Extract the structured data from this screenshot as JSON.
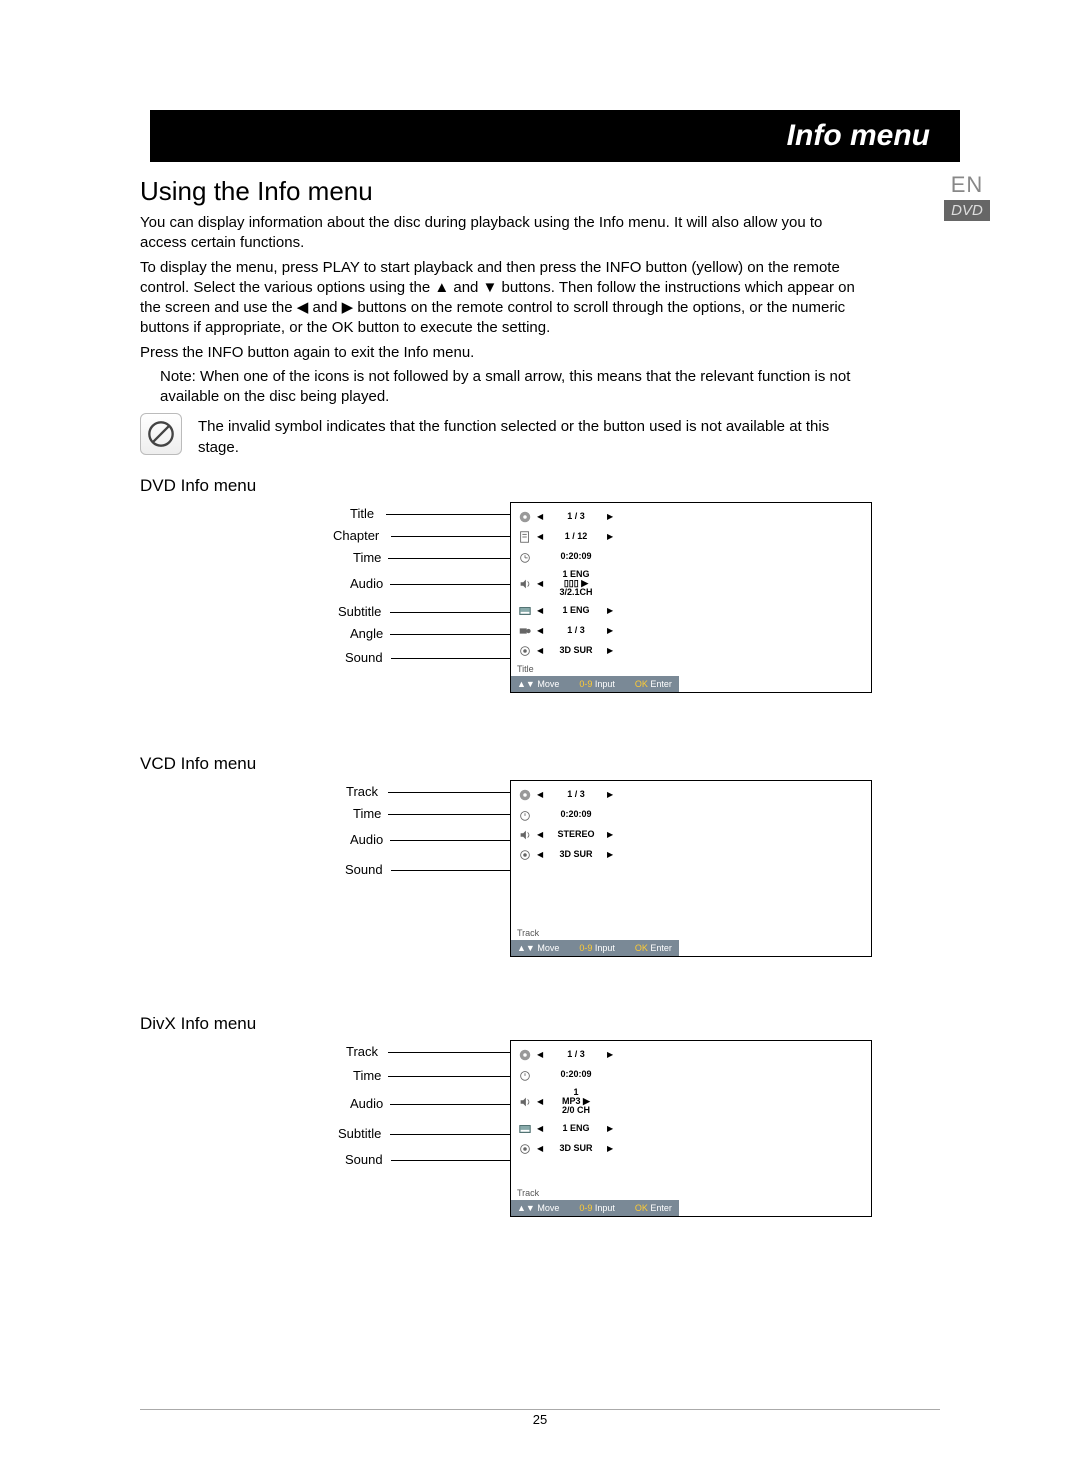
{
  "header": {
    "title": "Info menu"
  },
  "lang": {
    "code": "EN",
    "disc": "DVD"
  },
  "section_title": "Using the Info menu",
  "para1": "You can display information about the disc during playback using the Info menu. It will also allow you to access certain functions.",
  "para2": "To display the menu, press PLAY to start playback and then press the INFO button (yellow) on the remote control. Select the various options using the ▲ and ▼ buttons. Then follow the instructions which appear on the screen and use the ◀ and ▶ buttons on the remote control to scroll through the options, or the numeric buttons if appropriate, or the OK button to execute the setting.",
  "para3": "Press the INFO button again to exit the Info menu.",
  "note": "Note: When one of the icons is not followed by a small arrow, this means that the relevant function is not available on the disc being played.",
  "invalid_text": "The invalid symbol indicates that the function selected or the button used is not available at this stage.",
  "dvd": {
    "heading": "DVD Info menu",
    "callouts": [
      "Title",
      "Chapter",
      "Time",
      "Audio",
      "Subtitle",
      "Angle",
      "Sound"
    ],
    "rows": {
      "title": "1 / 3",
      "chapter": "1 / 12",
      "time": "0:20:09",
      "audio": "1 ENG\n▯▯▯ ▶\n3/2.1CH",
      "subtitle": "1 ENG",
      "angle": "1 / 3",
      "sound": "3D SUR"
    },
    "meta": "Title",
    "footer": {
      "move": "Move",
      "input_pre": "0-9",
      "input": " Input",
      "ok": "OK",
      "enter": " Enter"
    }
  },
  "vcd": {
    "heading": "VCD Info menu",
    "callouts": [
      "Track",
      "Time",
      "Audio",
      "Sound"
    ],
    "rows": {
      "track": "1 / 3",
      "time": "0:20:09",
      "audio": "STEREO",
      "sound": "3D SUR"
    },
    "meta": "Track",
    "footer": {
      "move": "Move",
      "input_pre": "0-9",
      "input": " Input",
      "ok": "OK",
      "enter": " Enter"
    }
  },
  "divx": {
    "heading": "DivX Info menu",
    "callouts": [
      "Track",
      "Time",
      "Audio",
      "Subtitle",
      "Sound"
    ],
    "rows": {
      "track": "1 / 3",
      "time": "0:20:09",
      "audio": "1\nMP3 ▶\n2/0 CH",
      "subtitle": "1 ENG",
      "sound": "3D SUR"
    },
    "meta": "Track",
    "footer": {
      "move": "Move",
      "input_pre": "0-9",
      "input": " Input",
      "ok": "OK",
      "enter": " Enter"
    }
  },
  "page_number": "25"
}
